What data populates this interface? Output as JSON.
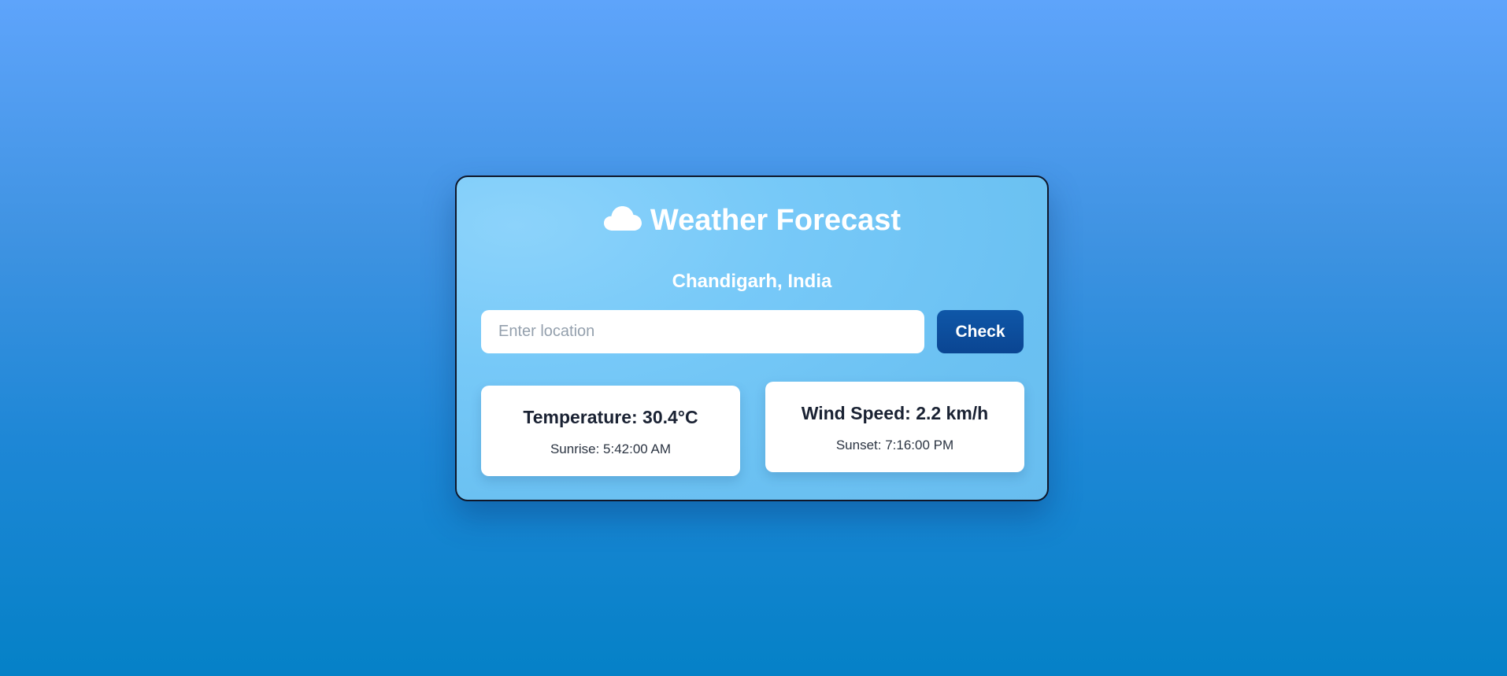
{
  "app": {
    "title": "Weather Forecast",
    "icon": "cloud-icon",
    "location": "Chandigarh, India"
  },
  "search": {
    "placeholder": "Enter location",
    "value": "",
    "button_label": "Check"
  },
  "cards": {
    "temperature": {
      "label": "Temperature: 30.4°C",
      "sub": "Sunrise: 5:42:00 AM"
    },
    "wind": {
      "label": "Wind Speed: 2.2 km/h",
      "sub": "Sunset: 7:16:00 PM"
    }
  },
  "colors": {
    "background_top": "#5ea4fb",
    "background_bottom": "#0581c7",
    "card": "#77c9f8",
    "button": "#0a4592",
    "text_dark": "#1a2233"
  }
}
